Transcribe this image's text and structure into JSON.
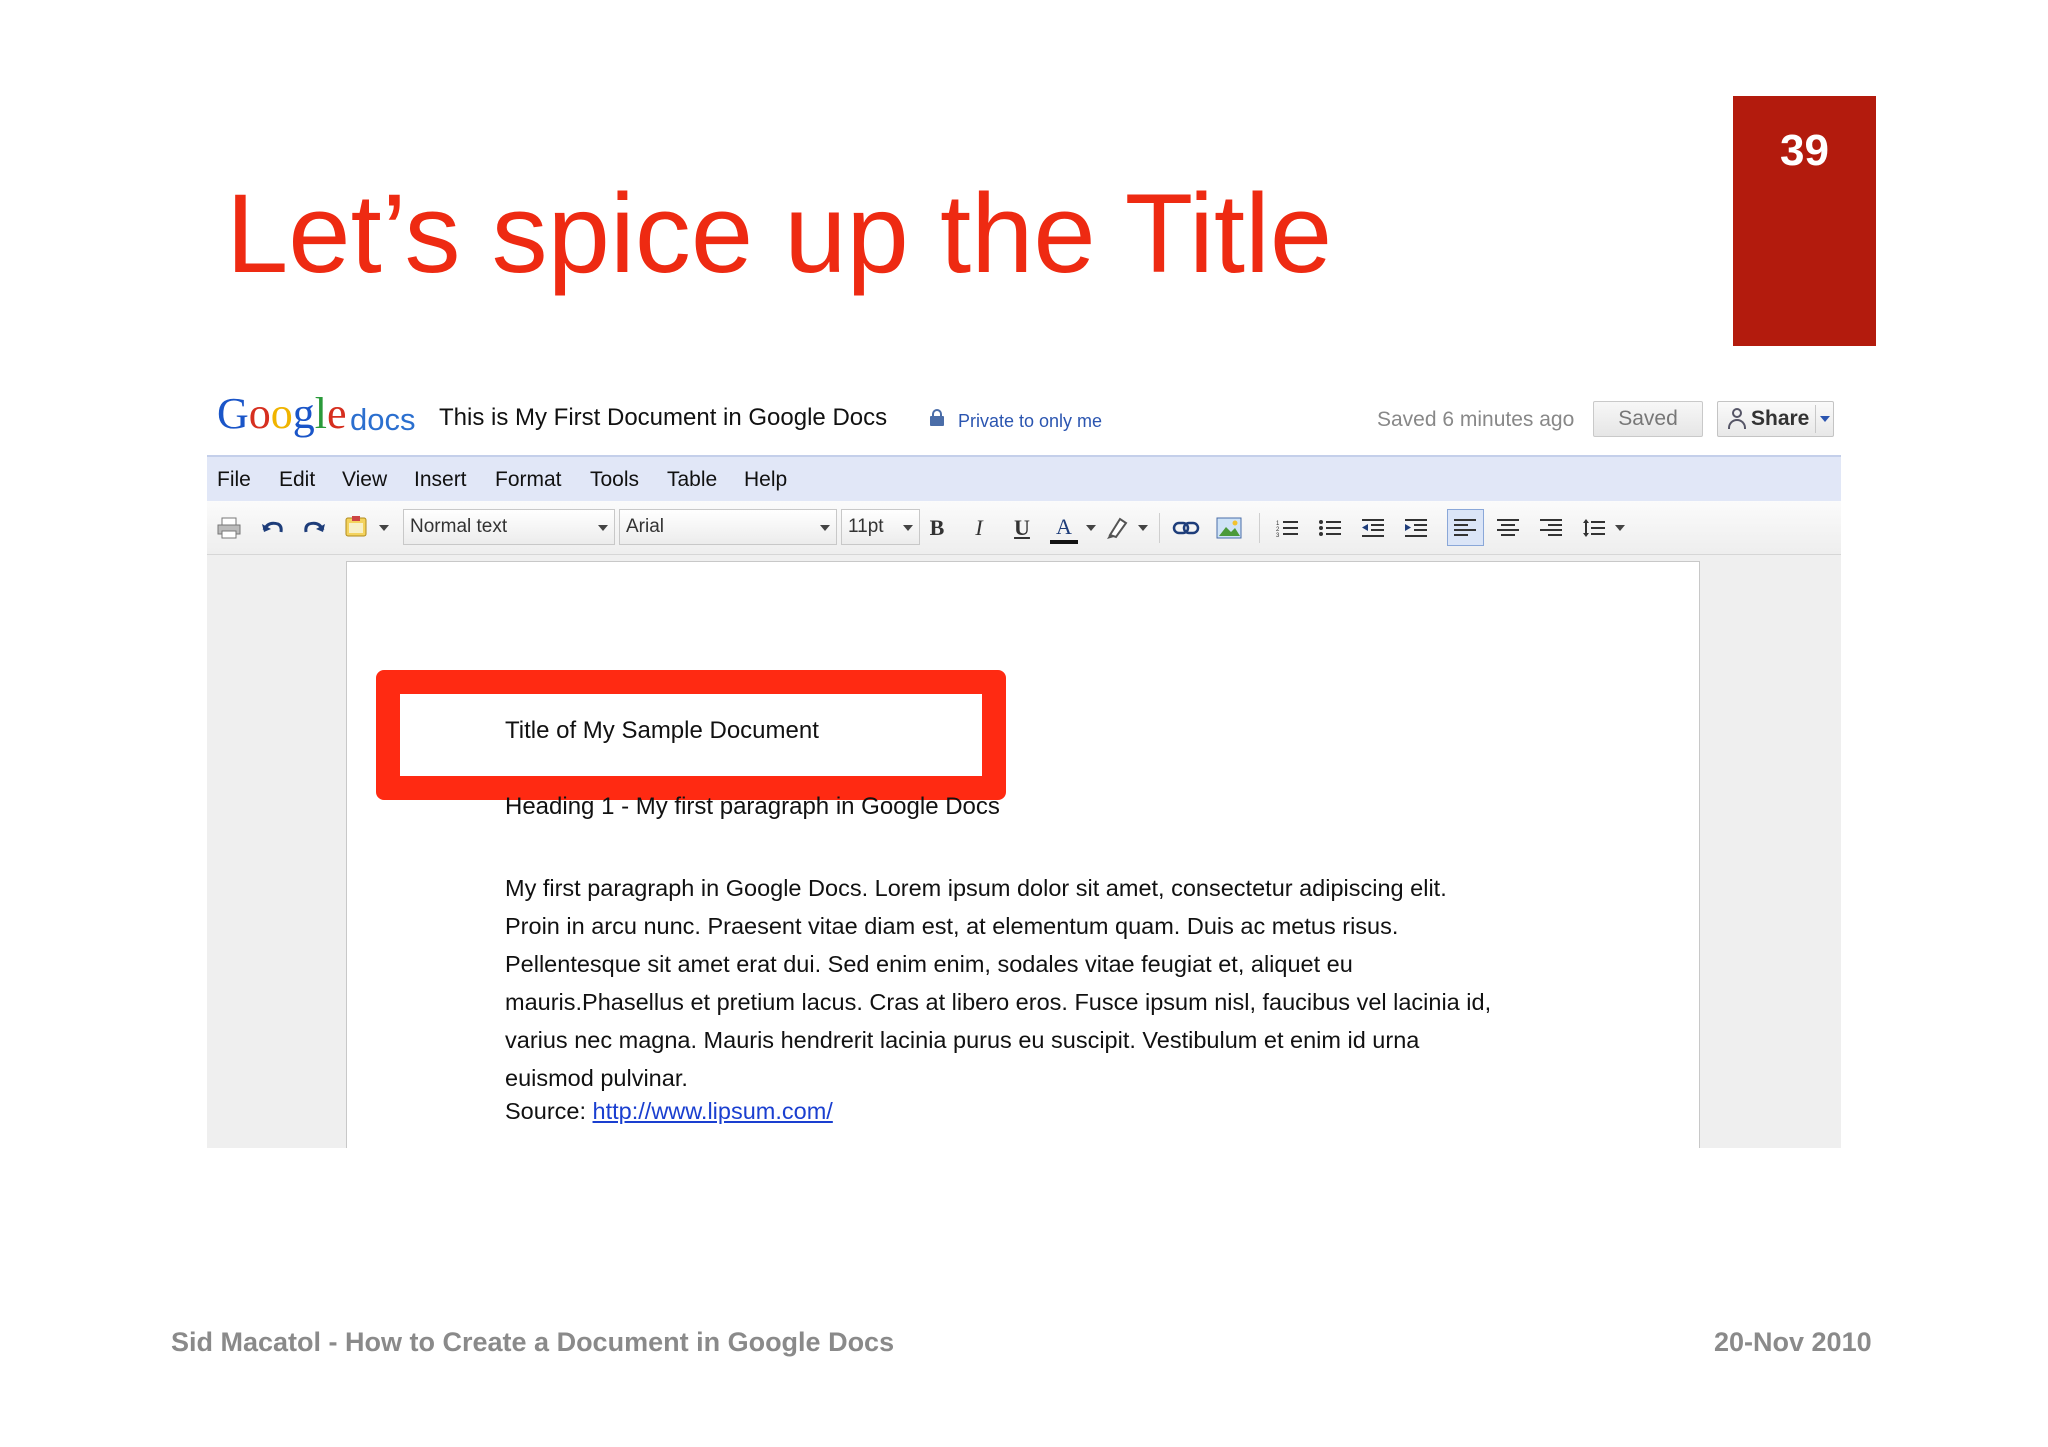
{
  "slide": {
    "number": "39",
    "title": "Let’s spice up the Title",
    "footer_left": "Sid Macatol - How to Create a Document in Google Docs",
    "footer_right": "20-Nov 2010",
    "accent_color": "#ee2a12",
    "number_box_color": "#b31b0d"
  },
  "app": {
    "logo_google": [
      "G",
      "o",
      "o",
      "g",
      "l",
      "e"
    ],
    "logo_docs": "docs",
    "document_title": "This is My First Document in Google Docs",
    "privacy_label": "Private to only me",
    "saved_status": "Saved 6 minutes ago",
    "saved_button": "Saved",
    "share_button": "Share"
  },
  "menu": [
    "File",
    "Edit",
    "View",
    "Insert",
    "Format",
    "Tools",
    "Table",
    "Help"
  ],
  "toolbar": {
    "style_select": "Normal text",
    "font_select": "Arial",
    "size_select": "11pt",
    "bold": "B",
    "italic": "I",
    "underline": "U",
    "text_color": "A",
    "icons": [
      "print-icon",
      "undo-icon",
      "redo-icon",
      "paint-format-icon",
      "bold-icon",
      "italic-icon",
      "underline-icon",
      "text-color-icon",
      "highlight-icon",
      "link-icon",
      "image-icon",
      "numbered-list-icon",
      "bulleted-list-icon",
      "decrease-indent-icon",
      "increase-indent-icon",
      "align-left-icon",
      "align-center-icon",
      "align-right-icon",
      "line-spacing-icon"
    ]
  },
  "document": {
    "title": "Title of My Sample Document",
    "heading": "Heading 1 - My first paragraph in Google Docs",
    "paragraph_lines": [
      "My first paragraph in Google Docs. Lorem ipsum dolor sit amet, consectetur adipiscing elit.",
      "Proin in arcu nunc. Praesent vitae diam est, at elementum quam. Duis ac metus risus.",
      "Pellentesque sit amet erat dui. Sed enim enim, sodales vitae feugiat et, aliquet eu",
      "mauris.Phasellus et pretium lacus. Cras at libero eros. Fusce ipsum nisl, faucibus vel lacinia id,",
      "varius nec magna. Mauris hendrerit lacinia purus eu suscipit. Vestibulum et enim id urna",
      "euismod pulvinar."
    ],
    "source_label": "Source:",
    "source_link": "http://www.lipsum.com/",
    "highlight_color": "#ff2a12"
  }
}
